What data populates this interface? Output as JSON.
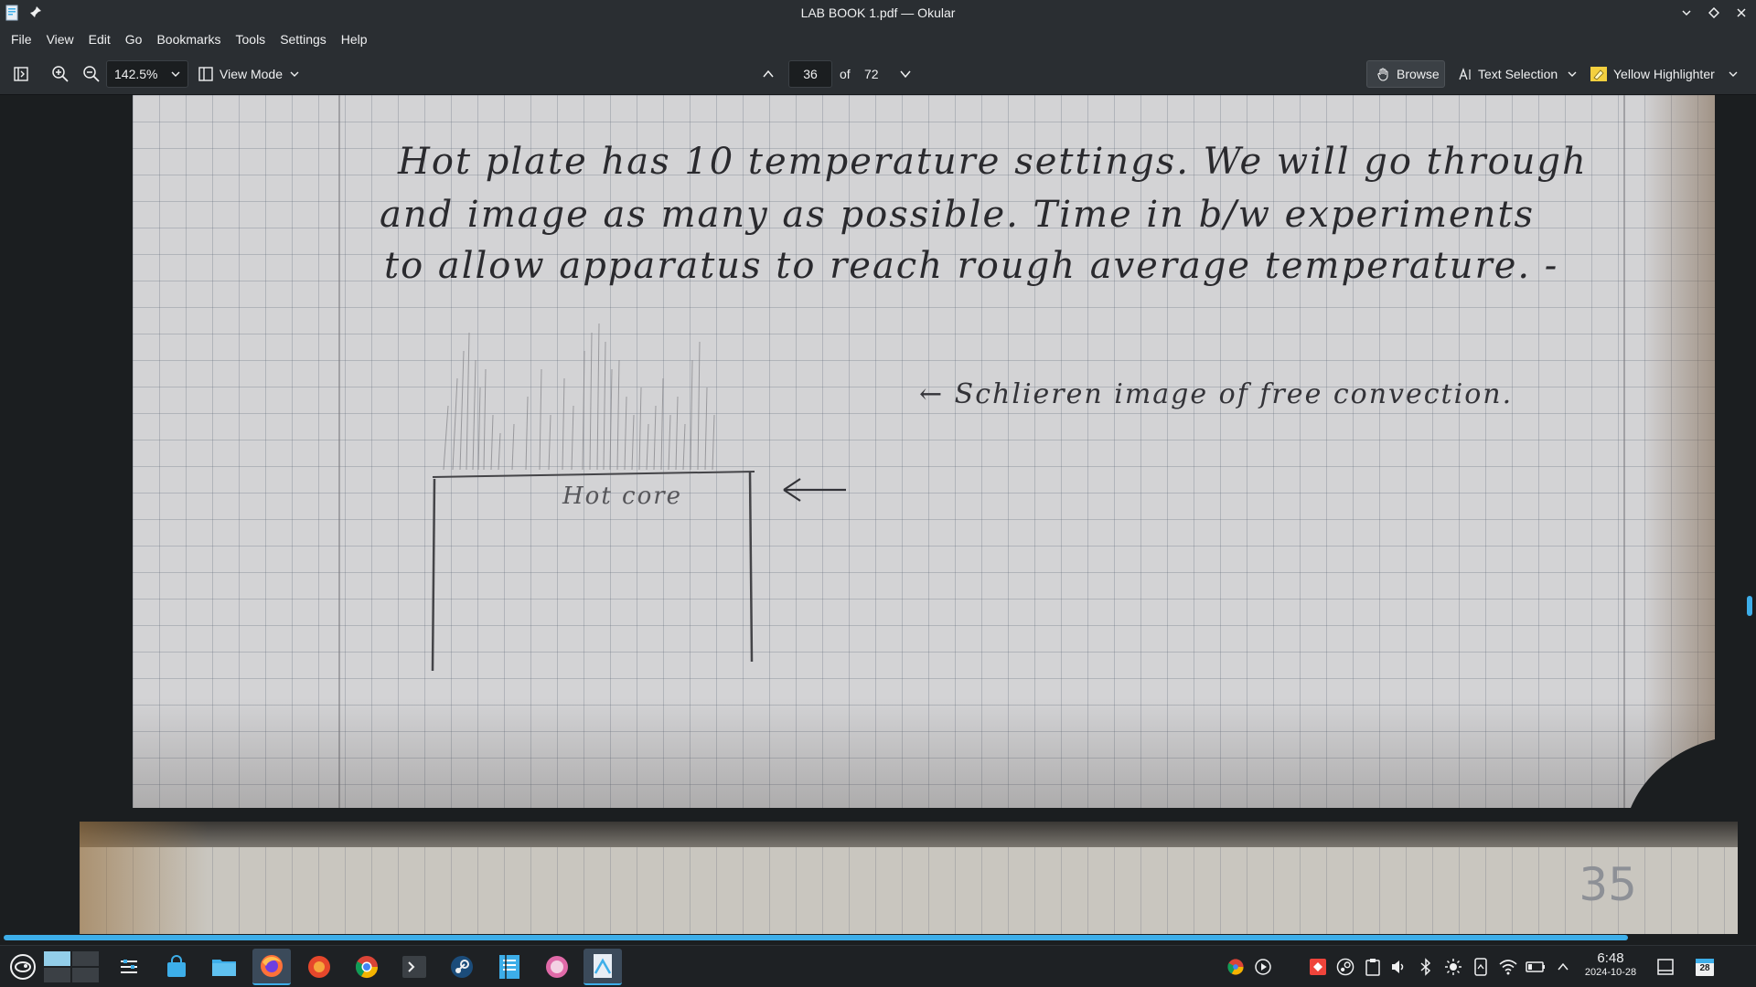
{
  "window": {
    "title": "LAB BOOK 1.pdf — Okular"
  },
  "menu": [
    "File",
    "View",
    "Edit",
    "Go",
    "Bookmarks",
    "Tools",
    "Settings",
    "Help"
  ],
  "toolbar": {
    "zoom": "142.5%",
    "view_mode": "View Mode",
    "current_page": "36",
    "of_label": "of",
    "total_pages": "72",
    "browse": "Browse",
    "text_selection": "Text Selection",
    "highlighter": "Yellow Highlighter",
    "highlighter_color": "#f4d03f"
  },
  "page_content": {
    "lines": [
      "Hot plate has 10 temperature settings. We will go through",
      "and image as many as possible. Time in b/w experiments",
      "to allow apparatus to reach rough average temperature. -"
    ],
    "annotation": "← Schlieren image of free convection.",
    "sketch_label": "Hot core",
    "next_page_number": "35"
  },
  "taskbar": {
    "clock_time": "6:48",
    "clock_date": "2024-10-28",
    "calendar_day": "28"
  },
  "colors": {
    "accent": "#3daee9",
    "panel": "#2a2e32",
    "background": "#1b1e20"
  }
}
